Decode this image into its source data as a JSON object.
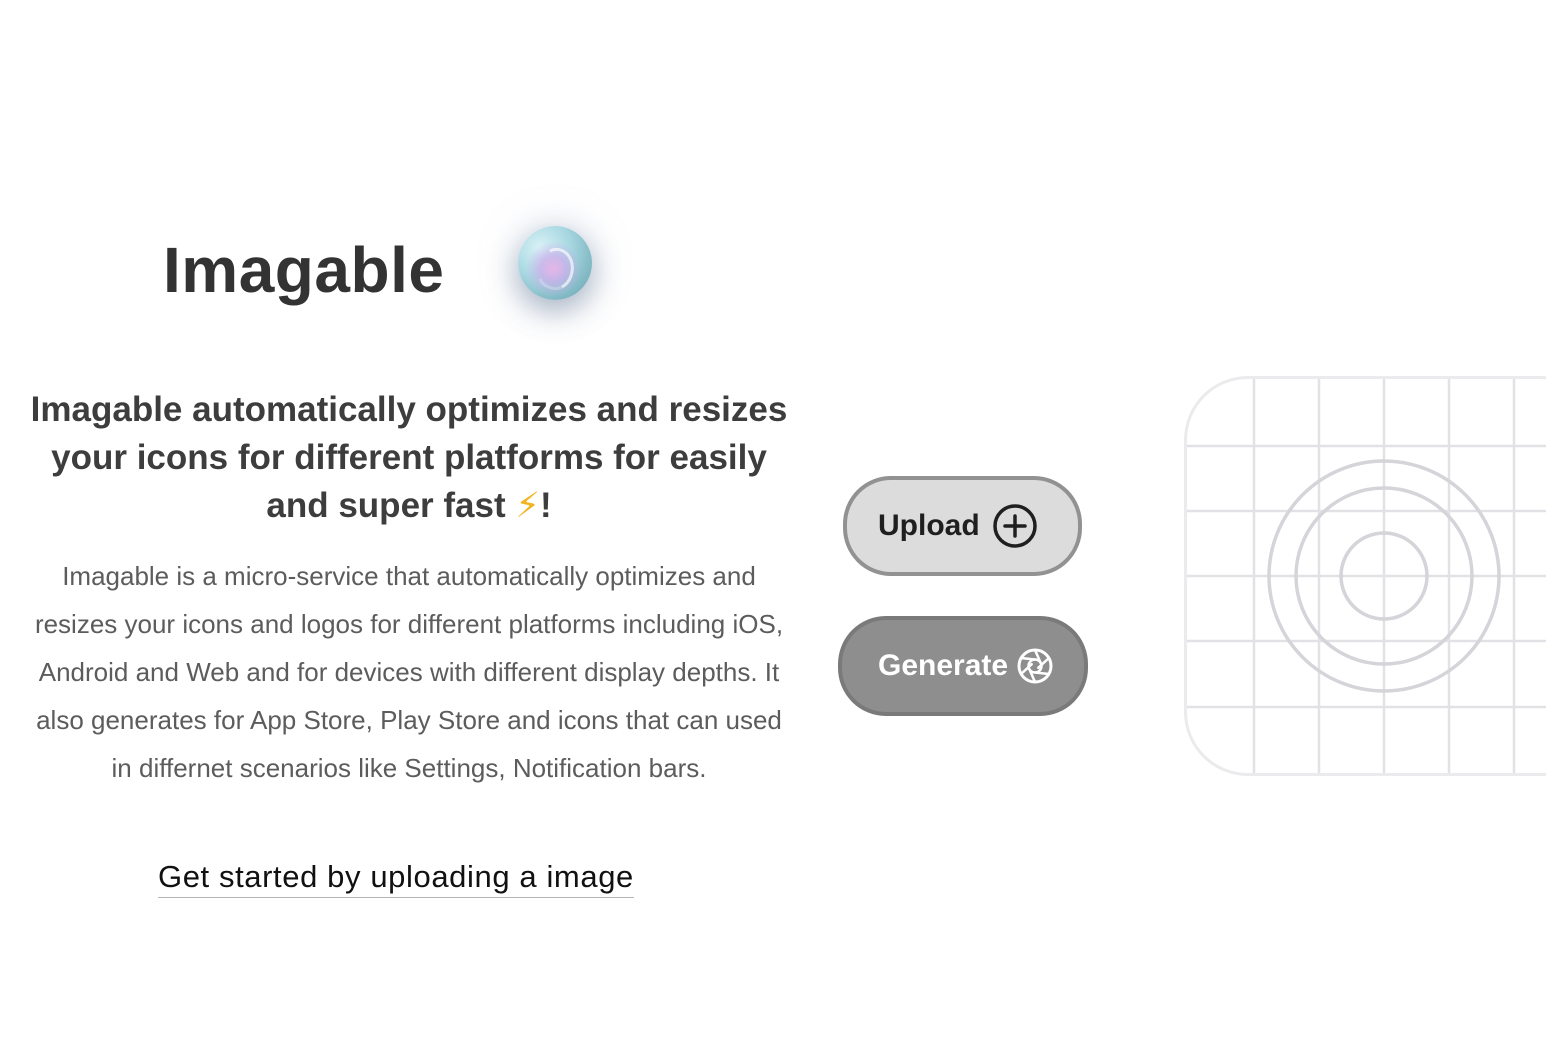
{
  "brand": {
    "title": "Imagable",
    "logo_icon": "orb-logo-icon"
  },
  "hero": {
    "headline": "Imagable automatically optimizes and resizes your icons for different platforms for easily and super fast",
    "headline_emoji": "⚡",
    "headline_end": "!",
    "description": "Imagable is a micro-service that automatically optimizes and resizes your icons and logos for different platforms including iOS, Android and Web and for devices with different display depths. It also generates for App Store, Play Store and icons that can used in differnet scenarios like Settings, Notification bars.",
    "cta_link": "Get started by uploading a image"
  },
  "actions": {
    "upload_label": "Upload",
    "upload_icon": "plus-circle-icon",
    "generate_label": "Generate",
    "generate_icon": "aperture-icon"
  },
  "preview": {
    "icon": "icon-template-grid"
  },
  "colors": {
    "title": "#333333",
    "headline": "#3d3d3d",
    "body": "#5c5c5c",
    "upload_bg": "#dcdcdc",
    "upload_border": "#929292",
    "generate_bg": "#8e8e8e",
    "grid_line": "#e2e2e6",
    "grid_circle": "#d4d4d9",
    "bolt": "#f2b320"
  }
}
